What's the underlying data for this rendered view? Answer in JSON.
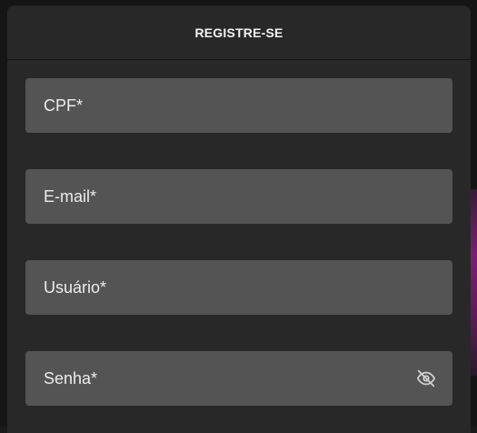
{
  "modal": {
    "title": "REGISTRE-SE"
  },
  "fields": [
    {
      "label": "CPF*",
      "value": ""
    },
    {
      "label": "E-mail*",
      "value": ""
    },
    {
      "label": "Usuário*",
      "value": ""
    },
    {
      "label": "Senha*",
      "value": "",
      "toggle_icon": "eye-off-icon"
    }
  ],
  "colors": {
    "modal_bg": "#282828",
    "field_bg": "#545454",
    "text": "#ececec",
    "accent": "#7a1f74"
  }
}
